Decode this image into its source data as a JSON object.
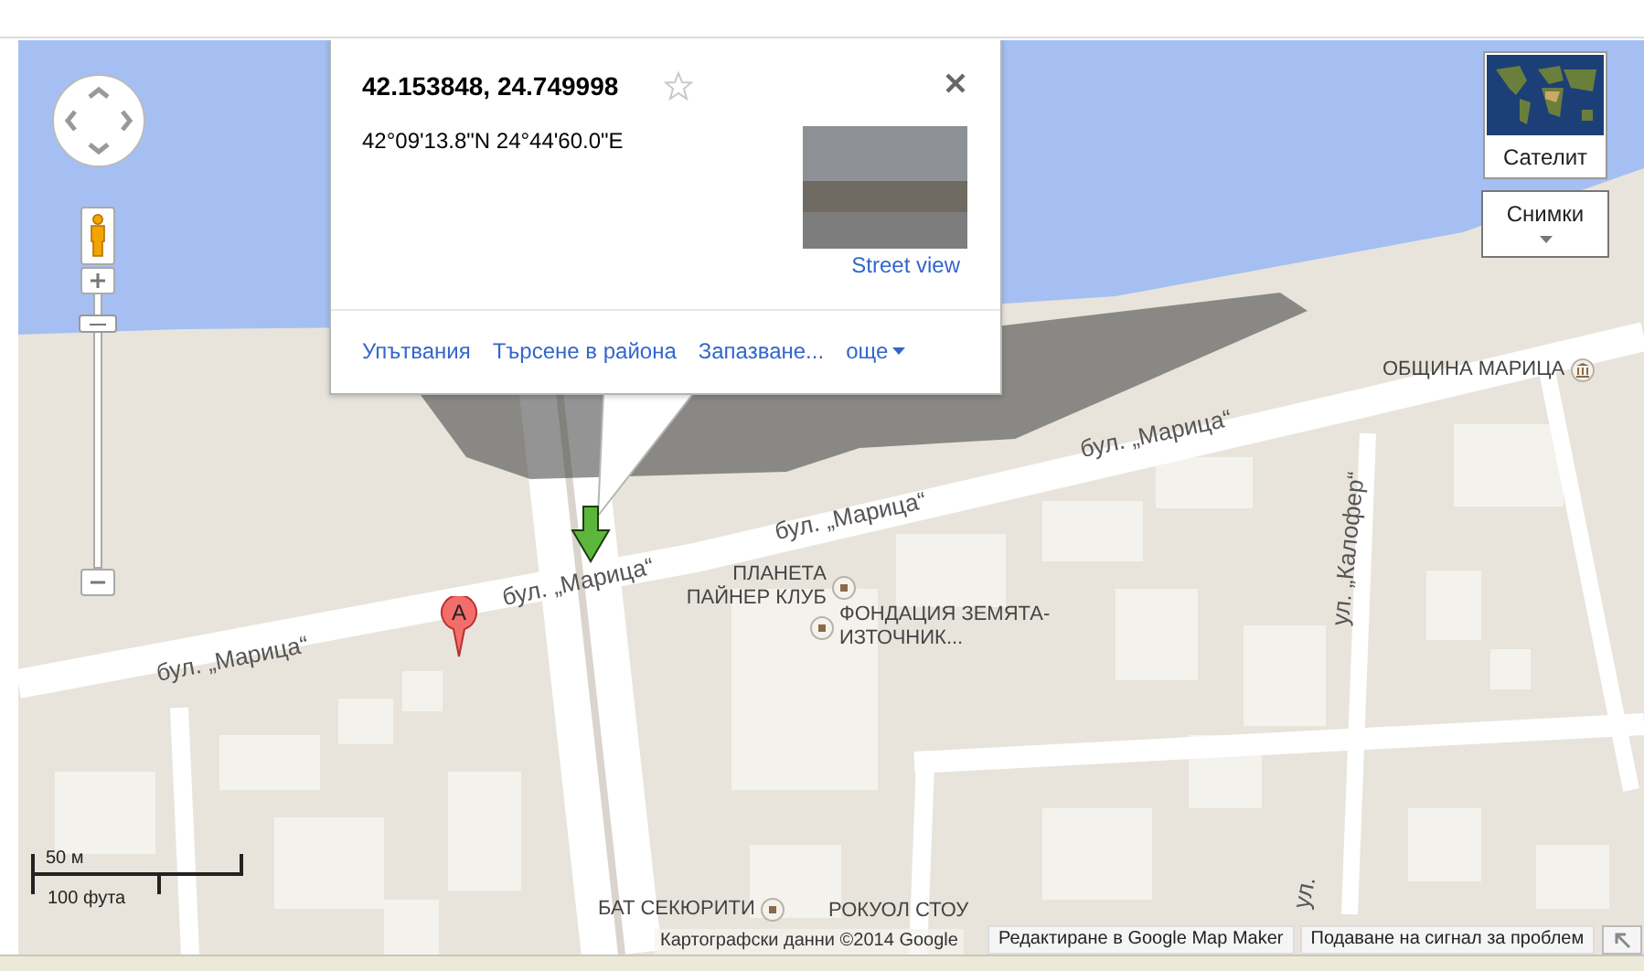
{
  "map_controls": {
    "zoom": {
      "level": 0.92
    }
  },
  "info_window": {
    "title": "42.153848, 24.749998",
    "starred": false,
    "coordinates": "42°09'13.8\"N 24°44'60.0\"E",
    "street_view_link": "Street view",
    "actions": [
      {
        "kind": "link",
        "label": "Упътвания"
      },
      {
        "kind": "link",
        "label": "Търсене в района"
      },
      {
        "kind": "link",
        "label": "Запазване..."
      },
      {
        "kind": "menu",
        "label": "още"
      }
    ]
  },
  "map_type": {
    "satellite": "Сателит",
    "imagery": "Снимки"
  },
  "map_labels": [
    {
      "kind": "street",
      "text": "бул. „Марица“"
    },
    {
      "kind": "street",
      "text": "бул. „Марица“"
    },
    {
      "kind": "street",
      "text": "бул. „Марица“"
    },
    {
      "kind": "street",
      "text": "бул. „Марица“"
    },
    {
      "kind": "street",
      "text": "ул. „Калофер“"
    },
    {
      "kind": "street",
      "text": "ул."
    },
    {
      "kind": "civic",
      "text": "ОБЩИНА МАРИЦА"
    },
    {
      "kind": "poi",
      "text": "ПЛАНЕТА ПАЙНЕР КЛУБ"
    },
    {
      "kind": "poi",
      "text": "ФОНДАЦИЯ ЗЕМЯТА-ИЗТОЧНИК..."
    },
    {
      "kind": "poi",
      "text": "БАТ СЕКЮРИТИ"
    },
    {
      "kind": "place",
      "text": "РОКУОЛ СТОУ"
    }
  ],
  "markers": [
    {
      "kind": "pin",
      "label": "A"
    },
    {
      "kind": "arrow"
    }
  ],
  "scale": {
    "metric": "50 м",
    "imperial": "100 фута"
  },
  "footer": {
    "attribution": "Картографски данни ©2014 Google",
    "links": [
      "Редактиране в Google Map Maker",
      "Подаване на сигнал за проблем"
    ]
  }
}
